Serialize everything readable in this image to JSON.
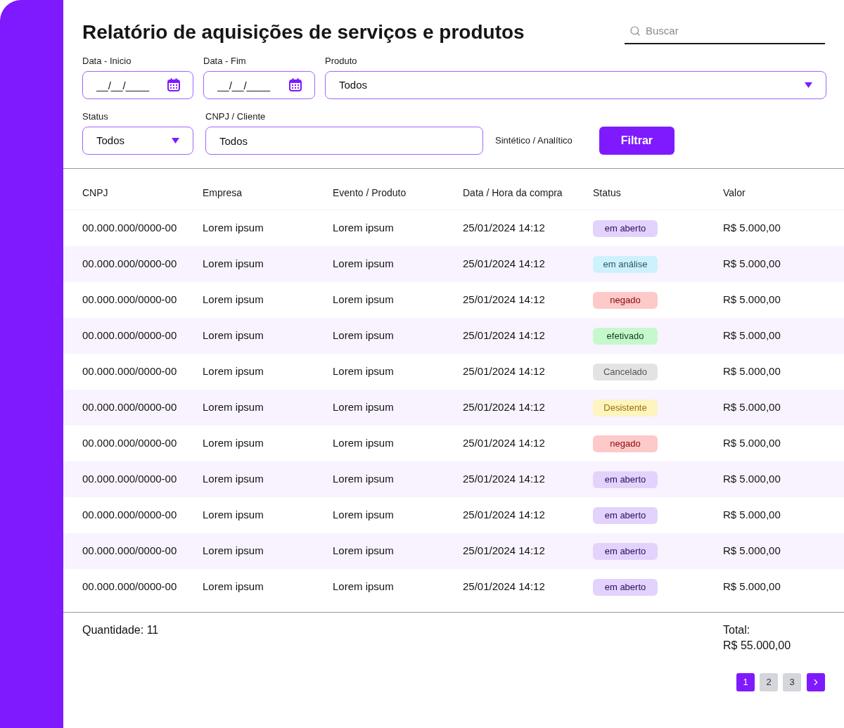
{
  "title": "Relatório de aquisições de serviços e produtos",
  "search": {
    "placeholder": "Buscar"
  },
  "filters": [
    {
      "label": "Data - Inicio",
      "kind": "date",
      "placeholder": "__/__/____"
    },
    {
      "label": "Data - Fim",
      "kind": "date",
      "placeholder": "__/__/____"
    },
    {
      "label": "Produto",
      "kind": "select",
      "value": "Todos"
    },
    {
      "label": "Status",
      "kind": "select",
      "value": "Todos"
    },
    {
      "label": "CNPJ / Cliente",
      "kind": "text",
      "value": "Todos"
    }
  ],
  "mode_label": "Sintético / Analítico",
  "filter_button": "Filtrar",
  "table": {
    "columns": [
      "CNPJ",
      "Empresa",
      "Evento / Produto",
      "Data / Hora da compra",
      "Status",
      "Valor"
    ],
    "rows": [
      {
        "cnpj": "00.000.000/0000-00",
        "company": "Lorem ipsum",
        "event_product": "Lorem ipsum",
        "purchase_datetime": "25/01/2024 14:12",
        "status": {
          "label": "em aberto",
          "kind": "open",
          "color": "#e2d3fd"
        },
        "value": "R$ 5.000,00"
      },
      {
        "cnpj": "00.000.000/0000-00",
        "company": "Lorem ipsum",
        "event_product": "Lorem ipsum",
        "purchase_datetime": "25/01/2024 14:12",
        "status": {
          "label": "em análise",
          "kind": "review",
          "color": "#cdf1fd"
        },
        "value": "R$ 5.000,00"
      },
      {
        "cnpj": "00.000.000/0000-00",
        "company": "Lorem ipsum",
        "event_product": "Lorem ipsum",
        "purchase_datetime": "25/01/2024 14:12",
        "status": {
          "label": "negado",
          "kind": "denied",
          "color": "#fdc9c9"
        },
        "value": "R$ 5.000,00"
      },
      {
        "cnpj": "00.000.000/0000-00",
        "company": "Lorem ipsum",
        "event_product": "Lorem ipsum",
        "purchase_datetime": "25/01/2024 14:12",
        "status": {
          "label": "efetivado",
          "kind": "done",
          "color": "#c6f8cd"
        },
        "value": "R$ 5.000,00"
      },
      {
        "cnpj": "00.000.000/0000-00",
        "company": "Lorem ipsum",
        "event_product": "Lorem ipsum",
        "purchase_datetime": "25/01/2024 14:12",
        "status": {
          "label": "Cancelado",
          "kind": "cancelled",
          "color": "#e3e3e3"
        },
        "value": "R$ 5.000,00"
      },
      {
        "cnpj": "00.000.000/0000-00",
        "company": "Lorem ipsum",
        "event_product": "Lorem ipsum",
        "purchase_datetime": "25/01/2024 14:12",
        "status": {
          "label": "Desistente",
          "kind": "withdrawn",
          "color": "#fdf4bf"
        },
        "value": "R$ 5.000,00"
      },
      {
        "cnpj": "00.000.000/0000-00",
        "company": "Lorem ipsum",
        "event_product": "Lorem ipsum",
        "purchase_datetime": "25/01/2024 14:12",
        "status": {
          "label": "negado",
          "kind": "denied",
          "color": "#fdc9c9"
        },
        "value": "R$ 5.000,00"
      },
      {
        "cnpj": "00.000.000/0000-00",
        "company": "Lorem ipsum",
        "event_product": "Lorem ipsum",
        "purchase_datetime": "25/01/2024 14:12",
        "status": {
          "label": "em aberto",
          "kind": "open",
          "color": "#e2d3fd"
        },
        "value": "R$ 5.000,00"
      },
      {
        "cnpj": "00.000.000/0000-00",
        "company": "Lorem ipsum",
        "event_product": "Lorem ipsum",
        "purchase_datetime": "25/01/2024 14:12",
        "status": {
          "label": "em aberto",
          "kind": "open",
          "color": "#e2d3fd"
        },
        "value": "R$ 5.000,00"
      },
      {
        "cnpj": "00.000.000/0000-00",
        "company": "Lorem ipsum",
        "event_product": "Lorem ipsum",
        "purchase_datetime": "25/01/2024 14:12",
        "status": {
          "label": "em aberto",
          "kind": "open",
          "color": "#e2d3fd"
        },
        "value": "R$ 5.000,00"
      },
      {
        "cnpj": "00.000.000/0000-00",
        "company": "Lorem ipsum",
        "event_product": "Lorem ipsum",
        "purchase_datetime": "25/01/2024 14:12",
        "status": {
          "label": "em aberto",
          "kind": "open",
          "color": "#e2d3fd"
        },
        "value": "R$ 5.000,00"
      }
    ]
  },
  "summary": {
    "quantity": "Quantidade: 11",
    "total_label": "Total:",
    "total_value": "R$ 55.000,00"
  },
  "pagination": {
    "pages": [
      {
        "label": "1",
        "selected": true
      },
      {
        "label": "2",
        "selected": false
      },
      {
        "label": "3",
        "selected": false
      }
    ]
  }
}
